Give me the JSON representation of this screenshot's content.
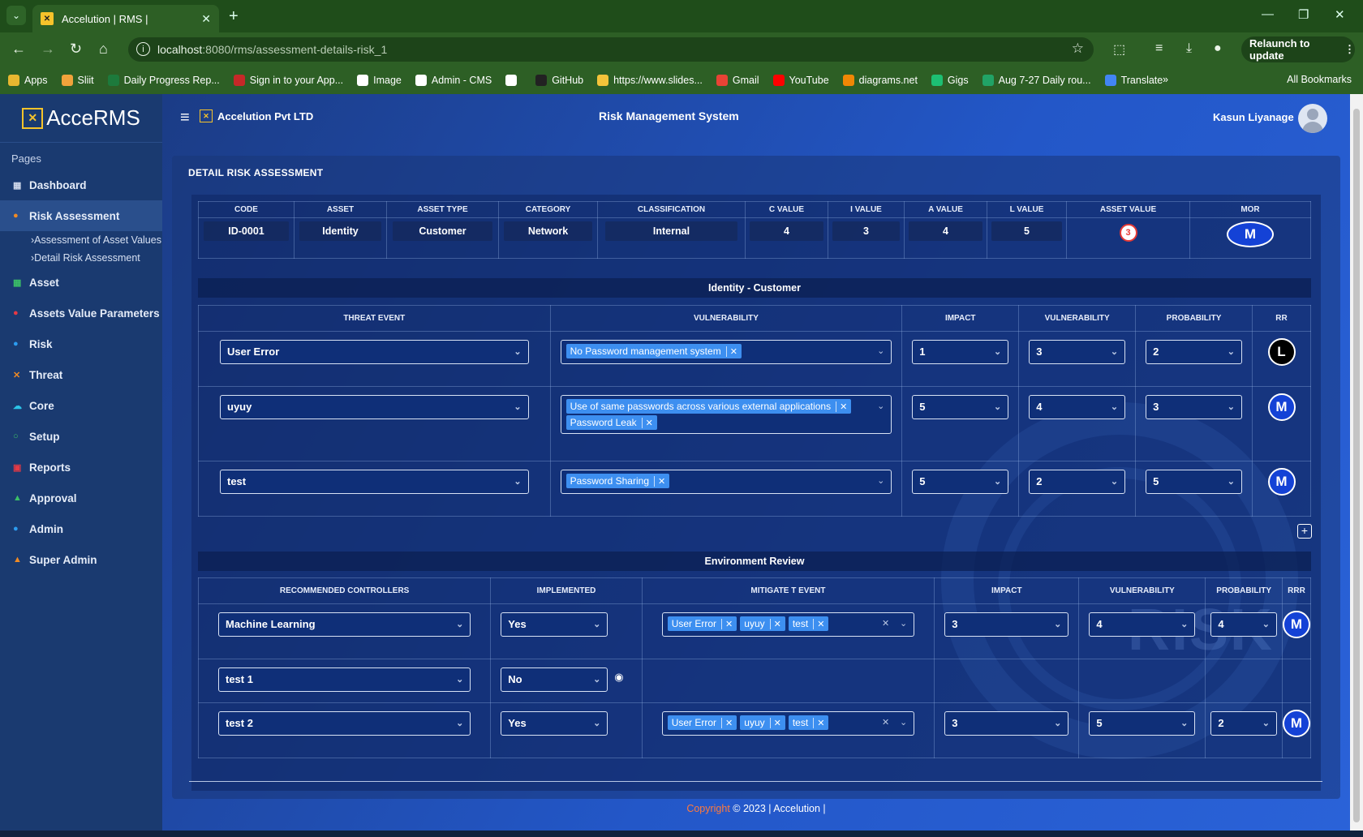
{
  "browser": {
    "tab_title": "Accelution | RMS |",
    "url_host": "localhost",
    "url_path": ":8080/rms/assessment-details-risk_1",
    "relaunch_label": "Relaunch to update",
    "bookmarks": [
      {
        "label": "Apps",
        "color": "#e8b730"
      },
      {
        "label": "Sliit",
        "color": "#f1a33b"
      },
      {
        "label": "Daily Progress Rep...",
        "color": "#1d7a3c"
      },
      {
        "label": "Sign in to your App...",
        "color": "#c62828"
      },
      {
        "label": "Image",
        "color": "#ffffff"
      },
      {
        "label": "Admin - CMS",
        "color": "#ffffff"
      },
      {
        "label": "",
        "color": "#ffffff"
      },
      {
        "label": "GitHub",
        "color": "#222222"
      },
      {
        "label": "https://www.slides...",
        "color": "#f3c33a"
      },
      {
        "label": "Gmail",
        "color": "#e84335"
      },
      {
        "label": "YouTube",
        "color": "#ff0000"
      },
      {
        "label": "diagrams.net",
        "color": "#f08705"
      },
      {
        "label": "Gigs",
        "color": "#1dbf73"
      },
      {
        "label": "Aug 7-27 Daily rou...",
        "color": "#21a366"
      },
      {
        "label": "Translate",
        "color": "#4285f4"
      }
    ],
    "all_bookmarks": "All Bookmarks"
  },
  "sidebar": {
    "logo": "AcceRMS",
    "pages_label": "Pages",
    "items": [
      {
        "label": "Dashboard",
        "icon": "▦",
        "color": "#cfd8ea"
      },
      {
        "label": "Risk Assessment",
        "icon": "●",
        "color": "#f08a24"
      },
      {
        "label": "Asset",
        "icon": "▦",
        "color": "#3bbf67"
      },
      {
        "label": "Assets Value Parameters",
        "icon": "●",
        "color": "#e53945"
      },
      {
        "label": "Risk",
        "icon": "●",
        "color": "#2c9cf0"
      },
      {
        "label": "Threat",
        "icon": "✕",
        "color": "#f08a24"
      },
      {
        "label": "Core",
        "icon": "☁",
        "color": "#2cc4e8"
      },
      {
        "label": "Setup",
        "icon": "○",
        "color": "#3bbf67"
      },
      {
        "label": "Reports",
        "icon": "▣",
        "color": "#e53945"
      },
      {
        "label": "Approval",
        "icon": "▲",
        "color": "#3bbf67"
      },
      {
        "label": "Admin",
        "icon": "●",
        "color": "#2c9cf0"
      },
      {
        "label": "Super Admin",
        "icon": "▲",
        "color": "#f08a24"
      }
    ],
    "sub_items": [
      "Assessment of Asset Values",
      "Detail Risk Assessment"
    ]
  },
  "header": {
    "company": "Accelution Pvt LTD",
    "app_title": "Risk Management System",
    "user_name": "Kasun Liyanage"
  },
  "card_title": "DETAIL RISK ASSESSMENT",
  "asset_table": {
    "headers": [
      "CODE",
      "ASSET",
      "ASSET TYPE",
      "CATEGORY",
      "CLASSIFICATION",
      "C VALUE",
      "I VALUE",
      "A VALUE",
      "L VALUE",
      "ASSET VALUE",
      "MOR"
    ],
    "row": {
      "code": "ID-0001",
      "asset": "Identity",
      "asset_type": "Customer",
      "category": "Network",
      "classification": "Internal",
      "c_value": "4",
      "i_value": "3",
      "a_value": "4",
      "l_value": "5",
      "asset_value": "3",
      "mor": "M"
    }
  },
  "threat_section": {
    "title": "Identity - Customer",
    "headers": [
      "THREAT EVENT",
      "VULNERABILITY",
      "IMPACT",
      "VULNERABILITY",
      "PROBABILITY",
      "RR"
    ],
    "rows": [
      {
        "threat": "User Error",
        "vulns": [
          "No Password management system"
        ],
        "impact": "1",
        "vulnerability": "3",
        "probability": "2",
        "rr": "L"
      },
      {
        "threat": "uyuy",
        "vulns": [
          "Use of same passwords across various external applications",
          "Password Leak"
        ],
        "impact": "5",
        "vulnerability": "4",
        "probability": "3",
        "rr": "M"
      },
      {
        "threat": "test",
        "vulns": [
          "Password Sharing"
        ],
        "impact": "5",
        "vulnerability": "2",
        "probability": "5",
        "rr": "M"
      }
    ]
  },
  "env_section": {
    "title": "Environment Review",
    "headers": [
      "RECOMMENDED CONTROLLERS",
      "IMPLEMENTED",
      "MITIGATE T EVENT",
      "IMPACT",
      "VULNERABILITY",
      "PROBABILITY",
      "RRR"
    ],
    "rows": [
      {
        "controller": "Machine Learning",
        "implemented": "Yes",
        "events": [
          "User Error",
          "uyuy",
          "test"
        ],
        "impact": "3",
        "vulnerability": "4",
        "probability": "4",
        "rrr": "M"
      },
      {
        "controller": "test 1",
        "implemented": "No",
        "events": [],
        "impact": "",
        "vulnerability": "",
        "probability": "",
        "rrr": ""
      },
      {
        "controller": "test 2",
        "implemented": "Yes",
        "events": [
          "User Error",
          "uyuy",
          "test"
        ],
        "impact": "3",
        "vulnerability": "5",
        "probability": "2",
        "rrr": "M"
      }
    ]
  },
  "watermark_text": "RISK",
  "footer": {
    "prefix": "Copyright",
    "suffix": "© 2023 | Accelution |"
  }
}
